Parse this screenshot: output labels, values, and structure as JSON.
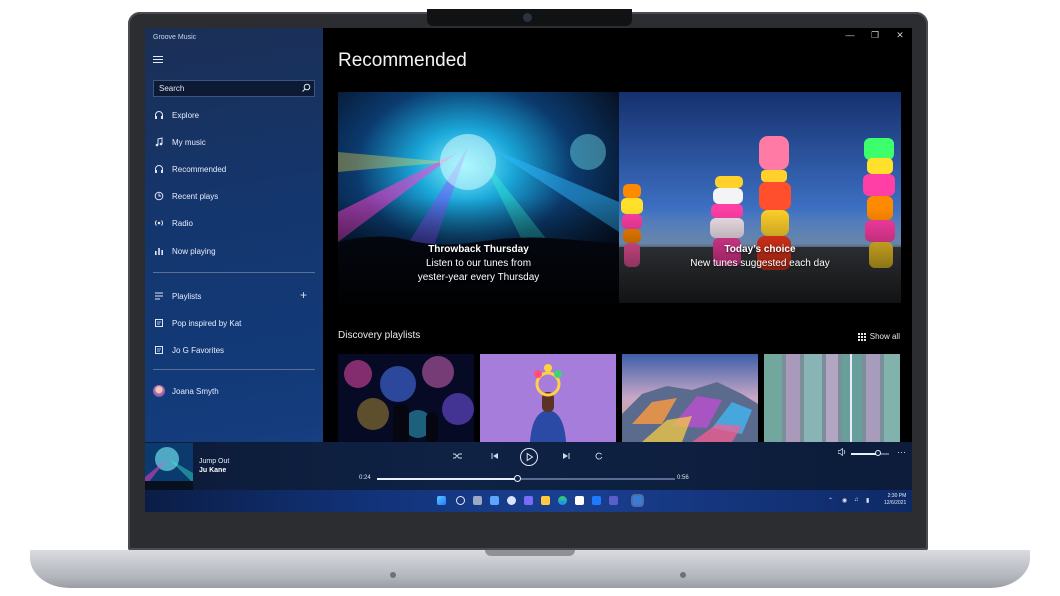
{
  "app": {
    "title": "Groove Music"
  },
  "search": {
    "placeholder": "Search"
  },
  "nav": {
    "items": [
      {
        "label": "Explore",
        "icon": "headphones-icon"
      },
      {
        "label": "My music",
        "icon": "music-note-icon"
      },
      {
        "label": "Recommended",
        "icon": "headphones-icon"
      },
      {
        "label": "Recent plays",
        "icon": "clock-icon"
      },
      {
        "label": "Radio",
        "icon": "radio-icon"
      },
      {
        "label": "Now playing",
        "icon": "equalizer-icon"
      }
    ],
    "playlists_label": "Playlists",
    "playlists": [
      {
        "label": "Pop inspired by Kat",
        "icon": "playlist-icon"
      },
      {
        "label": "Jo G Favorites",
        "icon": "playlist-icon"
      }
    ],
    "user": {
      "name": "Joana Smyth"
    }
  },
  "main": {
    "title": "Recommended",
    "heroes": [
      {
        "heading": "Throwback Thursday",
        "line1": "Listen to our tunes from",
        "line2": "yester-year every Thursday"
      },
      {
        "heading": "Today’s choice",
        "line1": "New tunes suggested each day"
      }
    ],
    "discovery": {
      "title": "Discovery playlists",
      "show_all": "Show all"
    }
  },
  "player": {
    "track_title": "Jump Out",
    "track_artist": "Ju Kane",
    "elapsed": "0:24",
    "duration": "0:56",
    "progress_fraction": 0.47,
    "volume_fraction": 0.7
  },
  "taskbar": {
    "time": "2:30 PM",
    "date": "12/6/2021"
  }
}
